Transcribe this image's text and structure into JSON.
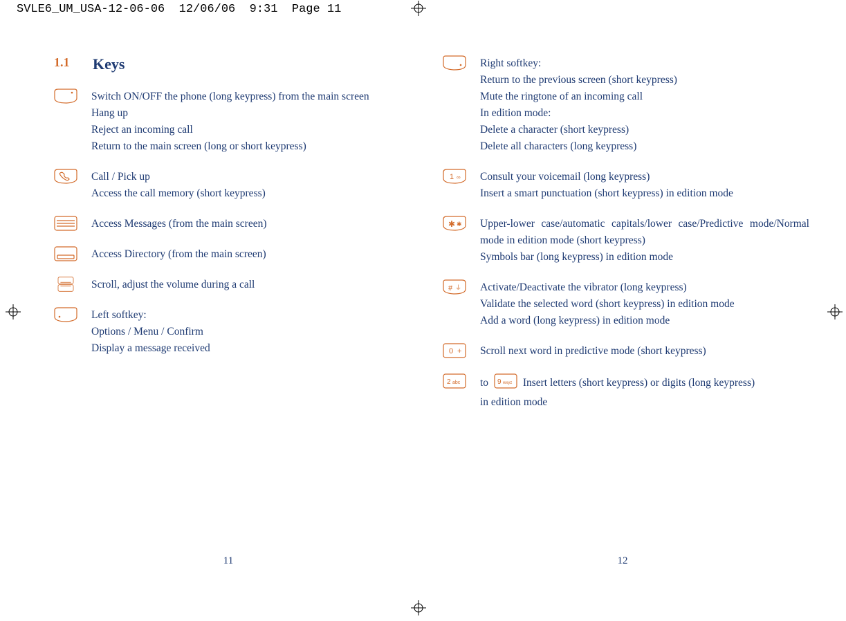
{
  "slugline": "SVLE6_UM_USA-12-06-06  12/06/06  9:31  Page 11",
  "section_number": "1.1",
  "section_title": "Keys",
  "page_left_number": "11",
  "page_right_number": "12",
  "left_items": [
    {
      "icon": "power-key-icon",
      "lines": [
        "Switch ON/OFF the phone (long keypress) from the main screen",
        "Hang up",
        "Reject an incoming call",
        "Return to the main screen (long or short keypress)"
      ]
    },
    {
      "icon": "call-key-icon",
      "lines": [
        "Call / Pick up",
        "Access the call memory (short keypress)"
      ]
    },
    {
      "icon": "messages-key-icon",
      "lines": [
        "Access Messages (from the main screen)"
      ]
    },
    {
      "icon": "directory-key-icon",
      "lines": [
        "Access Directory (from the main screen)"
      ]
    },
    {
      "icon": "scroll-key-icon",
      "lines": [
        "Scroll, adjust the volume during a call"
      ]
    },
    {
      "icon": "left-softkey-icon",
      "lines": [
        "Left softkey:",
        "Options / Menu / Confirm",
        "Display a message received"
      ]
    }
  ],
  "right_items": [
    {
      "icon": "right-softkey-icon",
      "lines": [
        "Right softkey:",
        "Return to the previous screen (short keypress)",
        "Mute the ringtone of an incoming call",
        "In edition mode:",
        "Delete a character (short keypress)",
        "Delete all characters (long keypress)"
      ]
    },
    {
      "icon": "one-key-icon",
      "lines": [
        "Consult your voicemail (long keypress)",
        "Insert a smart punctuation (short keypress) in edition mode"
      ]
    },
    {
      "icon": "star-key-icon",
      "justify": true,
      "lines": [
        "Upper-lower case/automatic capitals/lower case/Predictive mode/Normal mode in edition mode (short keypress)",
        "Symbols bar (long keypress) in edition mode"
      ]
    },
    {
      "icon": "hash-key-icon",
      "lines": [
        "Activate/Deactivate the vibrator (long keypress)",
        "Validate the selected word (short keypress) in edition mode",
        "Add a word (long keypress) in edition mode"
      ]
    },
    {
      "icon": "zero-key-icon",
      "lines": [
        "Scroll next word in predictive mode (short keypress)"
      ]
    }
  ],
  "last_item": {
    "icon_start": "two-key-icon",
    "to_label": "to",
    "icon_end": "nine-key-icon",
    "tail_first": "Insert letters (short keypress) or digits (long keypress)",
    "tail_second": "in edition mode"
  }
}
